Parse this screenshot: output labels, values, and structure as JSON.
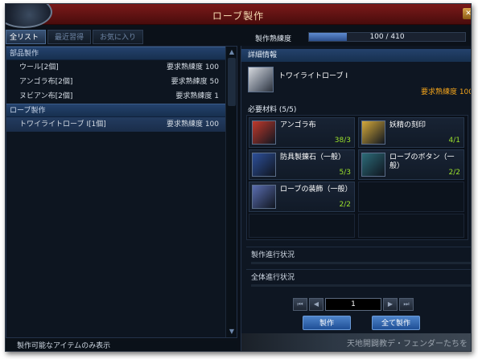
{
  "window": {
    "title": "ローブ製作"
  },
  "tabs": [
    {
      "label": "全リスト",
      "active": true
    },
    {
      "label": "最近習得",
      "active": false
    },
    {
      "label": "お気に入り",
      "active": false
    }
  ],
  "proficiency": {
    "label": "製作熟練度",
    "value": "100 / 410",
    "fill": 0.244
  },
  "recipe_list": {
    "categories": [
      {
        "label": "部品製作",
        "items": [
          {
            "name": "ウール[2個]",
            "req": "要求熟練度 100"
          },
          {
            "name": "アンゴラ布[2個]",
            "req": "要求熟練度   50"
          },
          {
            "name": "ヌビアン布[2個]",
            "req": "要求熟練度     1"
          }
        ]
      },
      {
        "label": "ローブ製作",
        "items": [
          {
            "name": "トワイライトローブ I[1個]",
            "req": "要求熟練度 100",
            "selected": true
          }
        ]
      }
    ],
    "footer": "製作可能なアイテムのみ表示"
  },
  "detail": {
    "header": "詳細情報",
    "product_name": "トワイライトローブ I",
    "product_req": "要求熟練度 100",
    "materials_label": "必要材料 (5/5)",
    "materials": [
      {
        "name": "アンゴラ布",
        "count": "38/3",
        "icon": "cloth-icon",
        "color": "#c0392b"
      },
      {
        "name": "妖精の刻印",
        "count": "4/1",
        "icon": "scroll-icon",
        "color": "#d4a93a"
      },
      {
        "name": "防具製錬石（一般）",
        "count": "5/3",
        "icon": "ore-icon",
        "color": "#2d4f9a"
      },
      {
        "name": "ローブのボタン（一般）",
        "count": "2/2",
        "icon": "button-icon",
        "color": "#2c6b78"
      },
      {
        "name": "ローブの装飾（一般）",
        "count": "2/2",
        "icon": "ornament-icon",
        "color": "#5a6db0"
      }
    ],
    "progress_label": "製作進行状況",
    "total_progress_label": "全体進行状況"
  },
  "pager": {
    "value": "1",
    "first": "⏮",
    "prev": "◀",
    "next": "▶",
    "last": "⏭"
  },
  "actions": {
    "craft": "製作",
    "craft_all": "全て製作"
  },
  "background_text": "天地開闢教デ・フェンダーたちを"
}
